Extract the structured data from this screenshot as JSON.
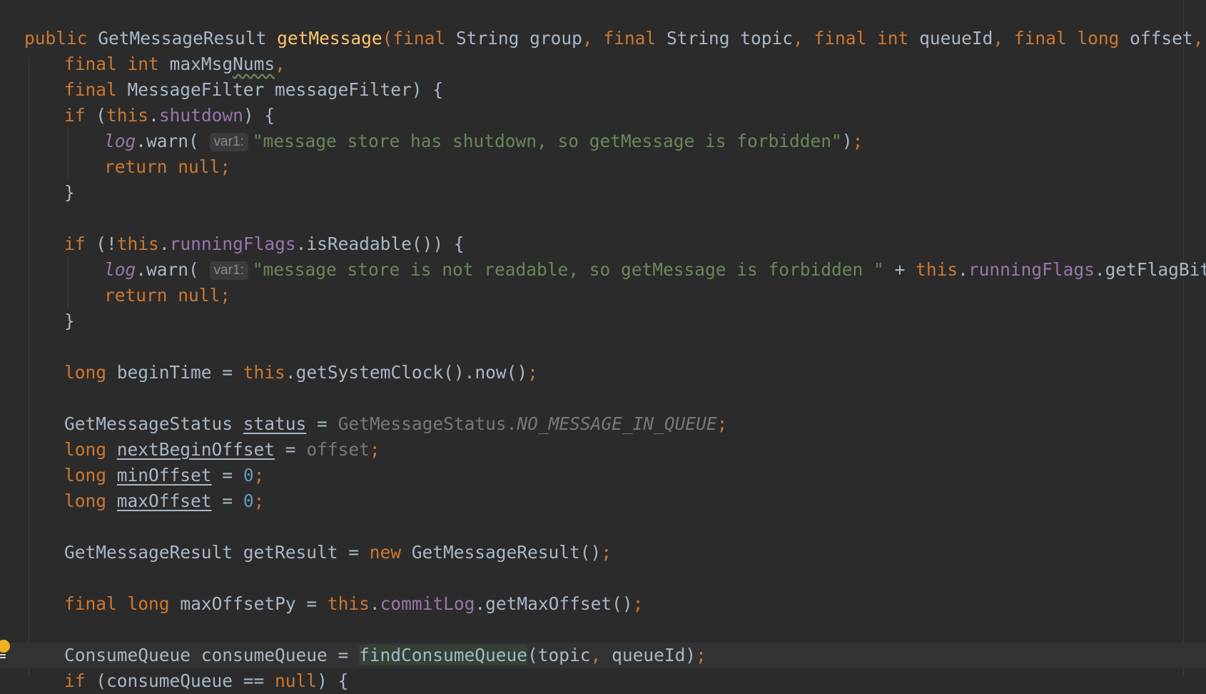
{
  "editor": {
    "theme_colors": {
      "background": "#2b2b2b",
      "keyword": "#cc7832",
      "string": "#6a8759",
      "field": "#9876aa",
      "method": "#ffc66d",
      "number": "#6897bb",
      "text": "#a9b7c6"
    },
    "hints": {
      "var1": "var1:"
    },
    "lines": {
      "l1": {
        "public": "public",
        "ret": "GetMessageResult",
        "name": "getMessage",
        "open": "(",
        "final1": "final",
        "t1": "String group",
        "c1": ",",
        "final2": "final",
        "t2": "String topic",
        "c2": ",",
        "final3": "final",
        "int1": "int",
        "t3": "queueId",
        "c3": ",",
        "final4": "final",
        "long1": "long",
        "t4": "offset",
        "c4": ","
      },
      "l2": {
        "final": "final",
        "int": "int",
        "name_a": "maxMsg",
        "name_b": "Nums",
        "comma": ","
      },
      "l3": {
        "final": "final",
        "rest": "MessageFilter messageFilter) {"
      },
      "l4": {
        "if": "if",
        "p1": "(",
        "this": "this",
        "dot": ".",
        "field": "shutdown",
        "p2": ") {"
      },
      "l5": {
        "log": "log",
        "warn": ".warn(",
        "str": "\"message store has shutdown, so getMessage is forbidden\"",
        "end": ")",
        "semi": ";"
      },
      "l6": {
        "return": "return null",
        "semi": ";"
      },
      "l7": {
        "brace": "}"
      },
      "l8": {
        "if": "if",
        "p1": "(!",
        "this": "this",
        "dot": ".",
        "field": "runningFlags",
        "rest": ".isReadable()) {"
      },
      "l9": {
        "log": "log",
        "warn": ".warn(",
        "str": "\"message store is not readable, so getMessage is forbidden \"",
        "plus": " + ",
        "this": "this",
        "dot": ".",
        "field": "runningFlags",
        "call": ".getFlagBits())",
        "semi": ";"
      },
      "l10": {
        "return": "return null",
        "semi": ";"
      },
      "l11": {
        "brace": "}"
      },
      "l12": {
        "long": "long",
        "rest": "beginTime = ",
        "this": "this",
        "call": ".getSystemClock().now()",
        "semi": ";"
      },
      "l13": {
        "type": "GetMessageStatus",
        "var": "status",
        "eq": " = ",
        "cls": "GetMessageStatus.",
        "const": "NO_MESSAGE_IN_QUEUE",
        "semi": ";"
      },
      "l14": {
        "long": "long",
        "var": "nextBeginOffset",
        "eq": " = ",
        "val": "offset",
        "semi": ";"
      },
      "l15": {
        "long": "long",
        "var": "minOffset",
        "eq": " = ",
        "val": "0",
        "semi": ";"
      },
      "l16": {
        "long": "long",
        "var": "maxOffset",
        "eq": " = ",
        "val": "0",
        "semi": ";"
      },
      "l17": {
        "rest": "GetMessageResult getResult = ",
        "new": "new",
        "call": "GetMessageResult()",
        "semi": ";"
      },
      "l18": {
        "final": "final",
        "long": "long",
        "rest": "maxOffsetPy = ",
        "this": "this",
        "dot": ".",
        "field": "commitLog",
        "call": ".getMaxOffset()",
        "semi": ";"
      },
      "l19": {
        "rest": "ConsumeQueue consumeQueue = ",
        "call": "findConsumeQueue",
        "args1": "(topic",
        "comma": ",",
        "args2": "queueId)",
        "semi": ";"
      },
      "l20": {
        "if": "if",
        "rest": "(consumeQueue == ",
        "null": "null",
        "end": ") {"
      }
    }
  },
  "gutter": {
    "intention_icon": "lightbulb-icon"
  }
}
